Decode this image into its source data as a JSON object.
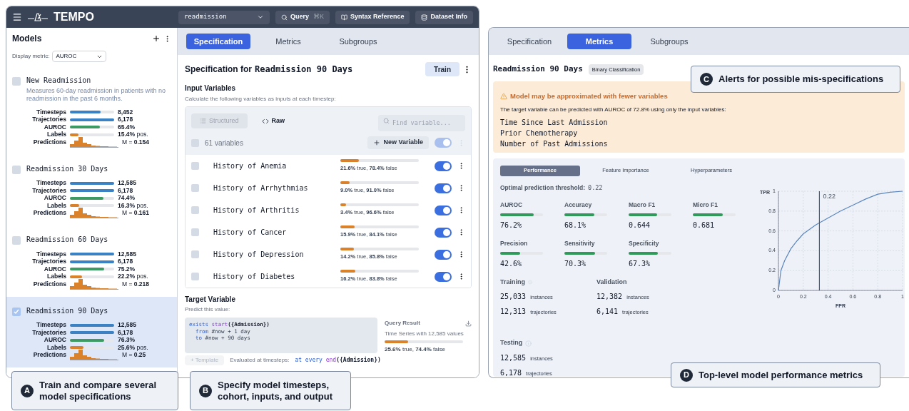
{
  "app": {
    "name": "TEMPO",
    "dataset": "readmission",
    "query_button": "Query",
    "query_shortcut": "⌘K",
    "syntax_button": "Syntax Reference",
    "dataset_button": "Dataset Info"
  },
  "sidebar": {
    "title": "Models",
    "metric_label": "Display metric:",
    "metric_value": "AUROC",
    "models": [
      {
        "name": "New Readmission",
        "description": "Measures 60-day readmission in patients with no readmission in the past 6 months.",
        "checked": false,
        "stats": [
          {
            "kind": "bar",
            "label": "Timesteps",
            "level": 0.69,
            "color": "#3b82c4",
            "value": "8,452"
          },
          {
            "kind": "bar",
            "label": "Trajectories",
            "level": 1,
            "color": "#3b82c4",
            "value": "6,178"
          },
          {
            "kind": "bar",
            "label": "AUROC",
            "level": 0.68,
            "color": "#3d9a62",
            "value": "65.4%"
          },
          {
            "kind": "bar",
            "label": "Labels",
            "level": 0.2,
            "color": "#d9822b",
            "value": "**15.4%** pos."
          },
          {
            "kind": "histogram",
            "label": "Predictions",
            "value": "M = **0.154**"
          }
        ]
      },
      {
        "name": "Readmission 30 Days",
        "checked": false,
        "stats": [
          {
            "kind": "bar",
            "label": "Timesteps",
            "level": 1,
            "color": "#3b82c4",
            "value": "12,585"
          },
          {
            "kind": "bar",
            "label": "Trajectories",
            "level": 1,
            "color": "#3b82c4",
            "value": "6,178"
          },
          {
            "kind": "bar",
            "label": "AUROC",
            "level": 0.76,
            "color": "#3d9a62",
            "value": "74.4%"
          },
          {
            "kind": "bar",
            "label": "Labels",
            "level": 0.21,
            "color": "#d9822b",
            "value": "**16.3%** pos."
          },
          {
            "kind": "histogram",
            "label": "Predictions",
            "value": "M = **0.161**"
          }
        ]
      },
      {
        "name": "Readmission 60 Days",
        "checked": false,
        "stats": [
          {
            "kind": "bar",
            "label": "Timesteps",
            "level": 1,
            "color": "#3b82c4",
            "value": "12,585"
          },
          {
            "kind": "bar",
            "label": "Trajectories",
            "level": 1,
            "color": "#3b82c4",
            "value": "6,178"
          },
          {
            "kind": "bar",
            "label": "AUROC",
            "level": 0.78,
            "color": "#3d9a62",
            "value": "75.2%"
          },
          {
            "kind": "bar",
            "label": "Labels",
            "level": 0.27,
            "color": "#d9822b",
            "value": "**22.2%** pos."
          },
          {
            "kind": "histogram",
            "label": "Predictions",
            "value": "M = **0.218**"
          }
        ]
      },
      {
        "name": "Readmission 90 Days",
        "checked": true,
        "stats": [
          {
            "kind": "bar",
            "label": "Timesteps",
            "level": 1,
            "color": "#3b82c4",
            "value": "12,585"
          },
          {
            "kind": "bar",
            "label": "Trajectories",
            "level": 1,
            "color": "#3b82c4",
            "value": "6,178"
          },
          {
            "kind": "bar",
            "label": "AUROC",
            "level": 0.78,
            "color": "#3d9a62",
            "value": "76.3%"
          },
          {
            "kind": "bar",
            "label": "Labels",
            "level": 0.3,
            "color": "#d9822b",
            "value": "**25.6%** pos."
          },
          {
            "kind": "histogram",
            "label": "Predictions",
            "value": "M = **0.25**"
          }
        ]
      }
    ]
  },
  "spec_panel": {
    "tabs": [
      {
        "label": "Specification",
        "selected": true
      },
      {
        "label": "Metrics",
        "selected": false
      },
      {
        "label": "Subgroups",
        "selected": false
      }
    ],
    "title_prefix": "Specification for",
    "title_model": "Readmission 90 Days",
    "train_button": "Train",
    "inputs": {
      "heading": "Input Variables",
      "description": "Calculate the following variables as inputs at each timestep:",
      "view_tabs": [
        {
          "label": "Structured",
          "selected": false
        },
        {
          "label": "Raw",
          "selected": true
        }
      ],
      "search": {
        "placeholder": "Find variable..."
      },
      "count": "61 variables",
      "all_checked": false,
      "new_button": "New Variable",
      "all_on": true,
      "toggle_disabled": true,
      "variables": [
        {
          "name": "History of Anemia",
          "checked": false,
          "level": 0.24,
          "stat": "**21.6%** true, **78.4%** false",
          "on": true
        },
        {
          "name": "History of Arrhythmias",
          "checked": false,
          "level": 0.12,
          "stat": "**9.0%** true, **91.0%** false",
          "on": true
        },
        {
          "name": "History of Arthritis",
          "checked": false,
          "level": 0.07,
          "stat": "**3.4%** true, **96.6%** false",
          "on": true
        },
        {
          "name": "History of Cancer",
          "checked": false,
          "level": 0.18,
          "stat": "**15.9%** true, **84.1%** false",
          "on": true
        },
        {
          "name": "History of Depression",
          "checked": false,
          "level": 0.17,
          "stat": "**14.2%** true, **85.8%** false",
          "on": true
        },
        {
          "name": "History of Diabetes",
          "checked": false,
          "level": 0.19,
          "stat": "**16.2%** true, **83.8%** false",
          "on": true
        }
      ]
    },
    "target": {
      "heading": "Target Variable",
      "description": "Predict this value:",
      "code": [
        [
          {
            "kind": "keyword",
            "text": "exists "
          },
          {
            "kind": "function",
            "text": "start"
          },
          {
            "kind": "bold",
            "text": "({Admission})"
          }
        ],
        [
          {
            "kind": "keyword",
            "text": "from"
          },
          {
            "kind": "plain",
            "text": " #now + 1 day"
          }
        ],
        [
          {
            "kind": "keyword",
            "text": "to"
          },
          {
            "kind": "plain",
            "text": " #now + 90 days"
          }
        ]
      ],
      "result_title": "Query Result",
      "result_desc": "Time Series with 12,585 values",
      "result_bar": {
        "level": 0.3
      },
      "result_stat": "**25.6%** true, **74.4%** false",
      "template_button": "+ Template",
      "evaluated_label": "Evaluated at timesteps:",
      "evaluated_code": [
        {
          "kind": "keyword",
          "text": "at every "
        },
        {
          "kind": "function",
          "text": "end"
        },
        {
          "kind": "bold",
          "text": "({Admission})"
        }
      ]
    }
  },
  "metrics_panel": {
    "tabs": [
      {
        "label": "Specification",
        "selected": false
      },
      {
        "label": "Metrics",
        "selected": true
      },
      {
        "label": "Subgroups",
        "selected": false
      }
    ],
    "title": "Readmission 90 Days",
    "badge": "Binary Classification",
    "alert": {
      "title": "Model may be approximated with fewer variables",
      "text": "The target variable can be predicted with AUROC of 72.8% using only the input variables:",
      "variables": [
        "Time Since Last Admission",
        "Prior Chemotherapy",
        "Number of Past Admissions"
      ]
    },
    "sub_tabs": [
      {
        "label": "Performance",
        "selected": true
      },
      {
        "label": "Feature Importance",
        "selected": false
      },
      {
        "label": "Hyperparameters",
        "selected": false
      }
    ],
    "threshold_label": "Optimal prediction threshold:",
    "threshold_value": "0.22",
    "metrics": [
      {
        "label": "AUROC",
        "level": 0.78,
        "value": "76.2%"
      },
      {
        "label": "Accuracy",
        "level": 0.7,
        "value": "68.1%"
      },
      {
        "label": "Macro F1",
        "level": 0.67,
        "value": "0.644"
      },
      {
        "label": "Micro F1",
        "level": 0.7,
        "value": "0.681"
      },
      {
        "label": "Precision",
        "level": 0.46,
        "value": "42.6%"
      },
      {
        "label": "Sensitivity",
        "level": 0.72,
        "value": "70.3%"
      },
      {
        "label": "Specificity",
        "level": 0.69,
        "value": "67.3%"
      }
    ],
    "splits": [
      {
        "label": "Training",
        "rows": [
          {
            "value": "25,033",
            "unit": "instances"
          },
          {
            "value": "12,313",
            "unit": "trajectories"
          }
        ]
      },
      {
        "label": "Validation",
        "rows": [
          {
            "value": "12,382",
            "unit": "instances"
          },
          {
            "value": "6,141",
            "unit": "trajectories"
          }
        ]
      },
      {
        "label": "Testing",
        "rows": [
          {
            "value": "12,585",
            "unit": "instances"
          },
          {
            "value": "6,178",
            "unit": "trajectories"
          }
        ]
      }
    ],
    "chart_data": {
      "type": "line",
      "xlabel": "FPR",
      "ylabel": "TPR",
      "x": [
        0,
        0.02,
        0.05,
        0.1,
        0.15,
        0.2,
        0.3,
        0.4,
        0.5,
        0.6,
        0.7,
        0.8,
        0.9,
        1
      ],
      "series": [
        {
          "color": "#5b86bf",
          "values": [
            0,
            0.2,
            0.3,
            0.42,
            0.5,
            0.57,
            0.66,
            0.73,
            0.8,
            0.86,
            0.92,
            0.97,
            0.99,
            1
          ]
        }
      ],
      "xlim": [
        0,
        1
      ],
      "ylim": [
        0,
        1
      ],
      "xticks": [
        0,
        0.2,
        0.4,
        0.6,
        0.8,
        1
      ],
      "yticks": [
        0,
        0.2,
        0.4,
        0.6,
        0.8,
        1
      ],
      "grid": true,
      "ref_lines": [
        {
          "axis": "x",
          "value": 0.33
        }
      ],
      "annotations": [
        "0.22"
      ]
    }
  },
  "callouts": [
    {
      "letter": "A",
      "text": "Train and compare several model specifications"
    },
    {
      "letter": "B",
      "text": "Specify model timesteps, cohort, inputs, and output"
    },
    {
      "letter": "C",
      "text": "Alerts for possible mis-specifications"
    },
    {
      "letter": "D",
      "text": "Top-level model performance metrics"
    }
  ]
}
